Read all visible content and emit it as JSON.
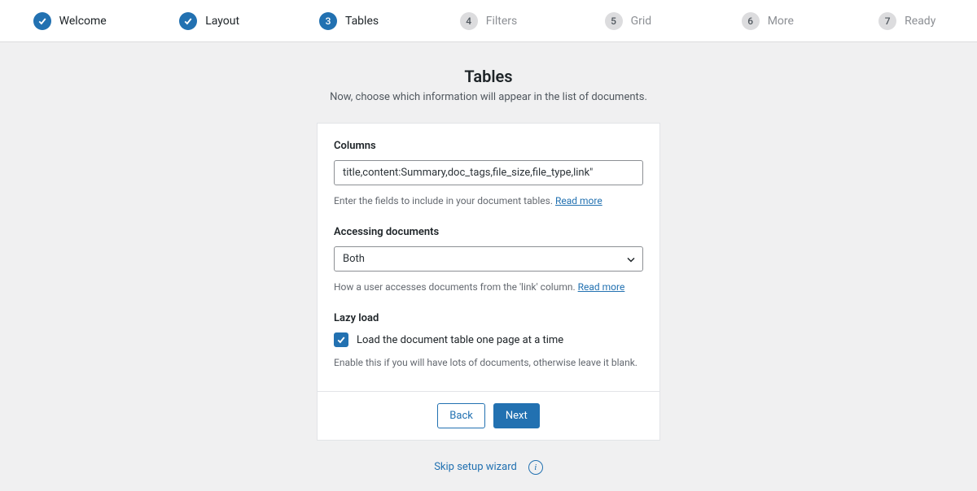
{
  "stepper": [
    {
      "label": "Welcome",
      "state": "completed"
    },
    {
      "label": "Layout",
      "state": "completed"
    },
    {
      "label": "Tables",
      "state": "current",
      "number": "3"
    },
    {
      "label": "Filters",
      "state": "upcoming",
      "number": "4"
    },
    {
      "label": "Grid",
      "state": "upcoming",
      "number": "5"
    },
    {
      "label": "More",
      "state": "upcoming",
      "number": "6"
    },
    {
      "label": "Ready",
      "state": "upcoming",
      "number": "7"
    }
  ],
  "header": {
    "title": "Tables",
    "subtitle": "Now, choose which information will appear in the list of documents."
  },
  "columns": {
    "label": "Columns",
    "value": "title,content:Summary,doc_tags,file_size,file_type,link\"",
    "help": "Enter the fields to include in your document tables.",
    "read_more": "Read more"
  },
  "access": {
    "label": "Accessing documents",
    "value": "Both",
    "options": [
      "Both"
    ],
    "help": "How a user accesses documents from the 'link' column.",
    "read_more": "Read more"
  },
  "lazy": {
    "label": "Lazy load",
    "checkbox_label": "Load the document table one page at a time",
    "checked": true,
    "help": "Enable this if you will have lots of documents, otherwise leave it blank."
  },
  "footer": {
    "back": "Back",
    "next": "Next",
    "skip": "Skip setup wizard"
  },
  "colors": {
    "accent": "#2271b1",
    "bg": "#f0f0f1"
  }
}
